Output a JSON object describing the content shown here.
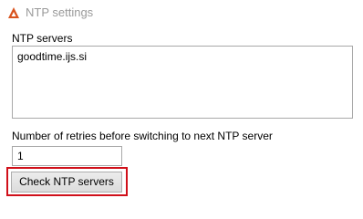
{
  "window": {
    "title": "NTP settings",
    "icon": "warning-triangle-icon"
  },
  "ntp_servers": {
    "label": "NTP servers",
    "value": "goodtime.ijs.si"
  },
  "retries": {
    "label": "Number of retries before switching to next NTP server",
    "value": "1"
  },
  "check_button": {
    "label": "Check NTP servers"
  },
  "colors": {
    "highlight": "#d0101a",
    "icon": "#d9531e",
    "title_text": "#9a9a9a"
  }
}
